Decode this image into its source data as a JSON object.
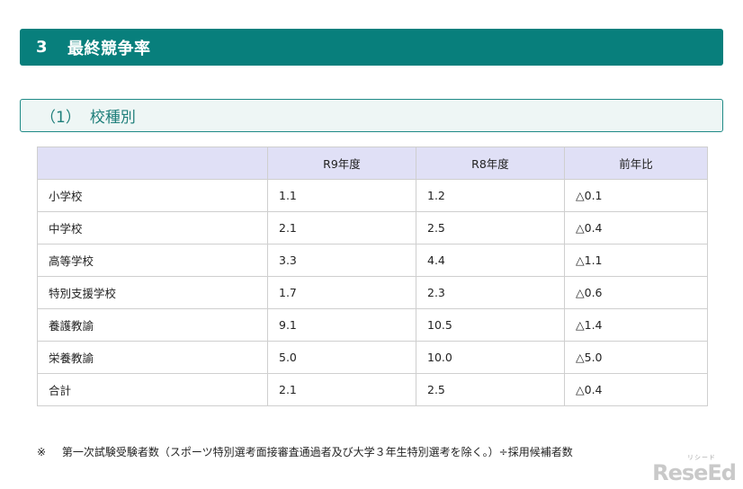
{
  "section": {
    "number": "3",
    "title": "最終競争率"
  },
  "subsection": {
    "number": "（1）",
    "title": "校種別"
  },
  "table": {
    "headers": [
      "",
      "R9年度",
      "R8年度",
      "前年比"
    ],
    "rows": [
      [
        "小学校",
        "1.1",
        "1.2",
        "△0.1"
      ],
      [
        "中学校",
        "2.1",
        "2.5",
        "△0.4"
      ],
      [
        "高等学校",
        "3.3",
        "4.4",
        "△1.1"
      ],
      [
        "特別支援学校",
        "1.7",
        "2.3",
        "△0.6"
      ],
      [
        "養護教諭",
        "9.1",
        "10.5",
        "△1.4"
      ],
      [
        "栄養教諭",
        "5.0",
        "10.0",
        "△5.0"
      ],
      [
        "合計",
        "2.1",
        "2.5",
        "△0.4"
      ]
    ]
  },
  "note": {
    "mark": "※",
    "text": "第一次試験受験者数（スポーツ特別選考面接審査通過者及び大学３年生特別選考を除く。）÷採用候補者数"
  },
  "logo": {
    "ruby": "リシード",
    "text": "ReseEd"
  }
}
